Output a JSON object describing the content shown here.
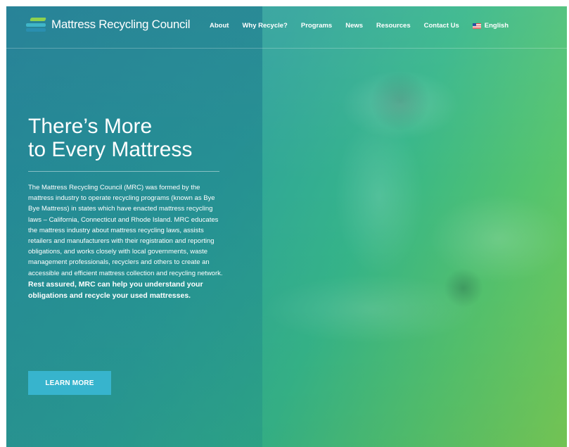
{
  "header": {
    "logo_text": "Mattress Recycling Council",
    "nav": [
      "About",
      "Why Recycle?",
      "Programs",
      "News",
      "Resources",
      "Contact Us"
    ],
    "language": "English",
    "language_icon": "us-flag-icon"
  },
  "hero": {
    "title_line1": "There’s More",
    "title_line2": "to Every Mattress",
    "body": "The Mattress Recycling Council (MRC) was formed by the mattress industry to operate recycling programs (known as Bye Bye Mattress) in states which have enacted mattress recycling laws – California, Connecticut and Rhode Island. MRC educates the mattress industry about mattress recycling laws, assists retailers and manufacturers with their registration and reporting obligations, and works closely with local governments, waste management professionals, recyclers and others to create an accessible and efficient mattress collection and recycling network.",
    "body_bold": "Rest assured, MRC can help you understand your obligations and recycle your used mattresses.",
    "cta_label": "LEARN MORE"
  },
  "colors": {
    "accent": "#37b4cd",
    "gradient_start": "#2d8ea0",
    "gradient_end": "#79cd57"
  }
}
